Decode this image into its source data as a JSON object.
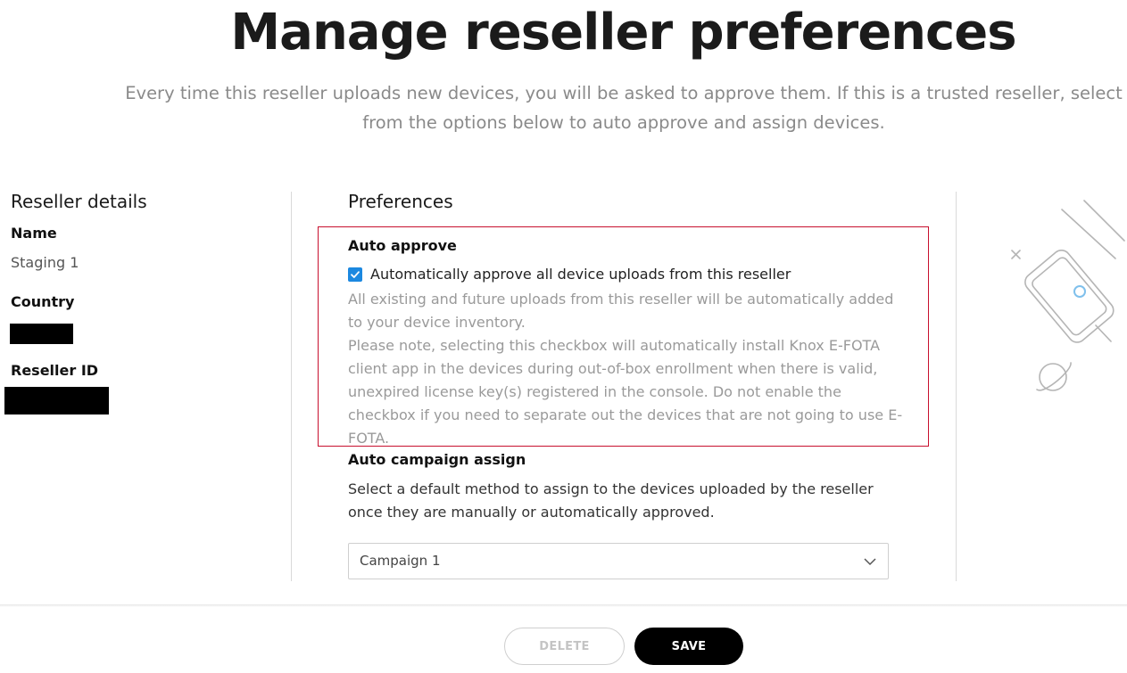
{
  "header": {
    "title": "Manage reseller preferences",
    "subtitle": "Every time this reseller uploads new devices, you will be asked to approve them. If this is a trusted reseller, select from the options below to auto approve and assign devices."
  },
  "reseller_details": {
    "heading": "Reseller details",
    "name_label": "Name",
    "name_value": "Staging 1",
    "country_label": "Country",
    "reseller_id_label": "Reseller ID"
  },
  "preferences": {
    "heading": "Preferences",
    "auto_approve": {
      "heading": "Auto approve",
      "checkbox_label": "Automatically approve all device uploads from this reseller",
      "checked": true,
      "help_line1": "All existing and future uploads from this reseller will be automatically added to your device inventory.",
      "help_line2": "Please note, selecting this checkbox will automatically install Knox E-FOTA client app in the devices during out-of-box enrollment when there is valid, unexpired license key(s) registered in the console. Do not enable the checkbox if you need to separate out the devices that are not going to use E-FOTA."
    },
    "auto_campaign": {
      "heading": "Auto campaign assign",
      "description": "Select a default method to assign to the devices uploaded by the reseller once they are manually or automatically approved.",
      "selected": "Campaign 1"
    }
  },
  "footer": {
    "delete_label": "DELETE",
    "save_label": "SAVE"
  },
  "colors": {
    "accent": "#1c88e0",
    "highlight_border": "#c8102e",
    "primary_button": "#000000"
  }
}
